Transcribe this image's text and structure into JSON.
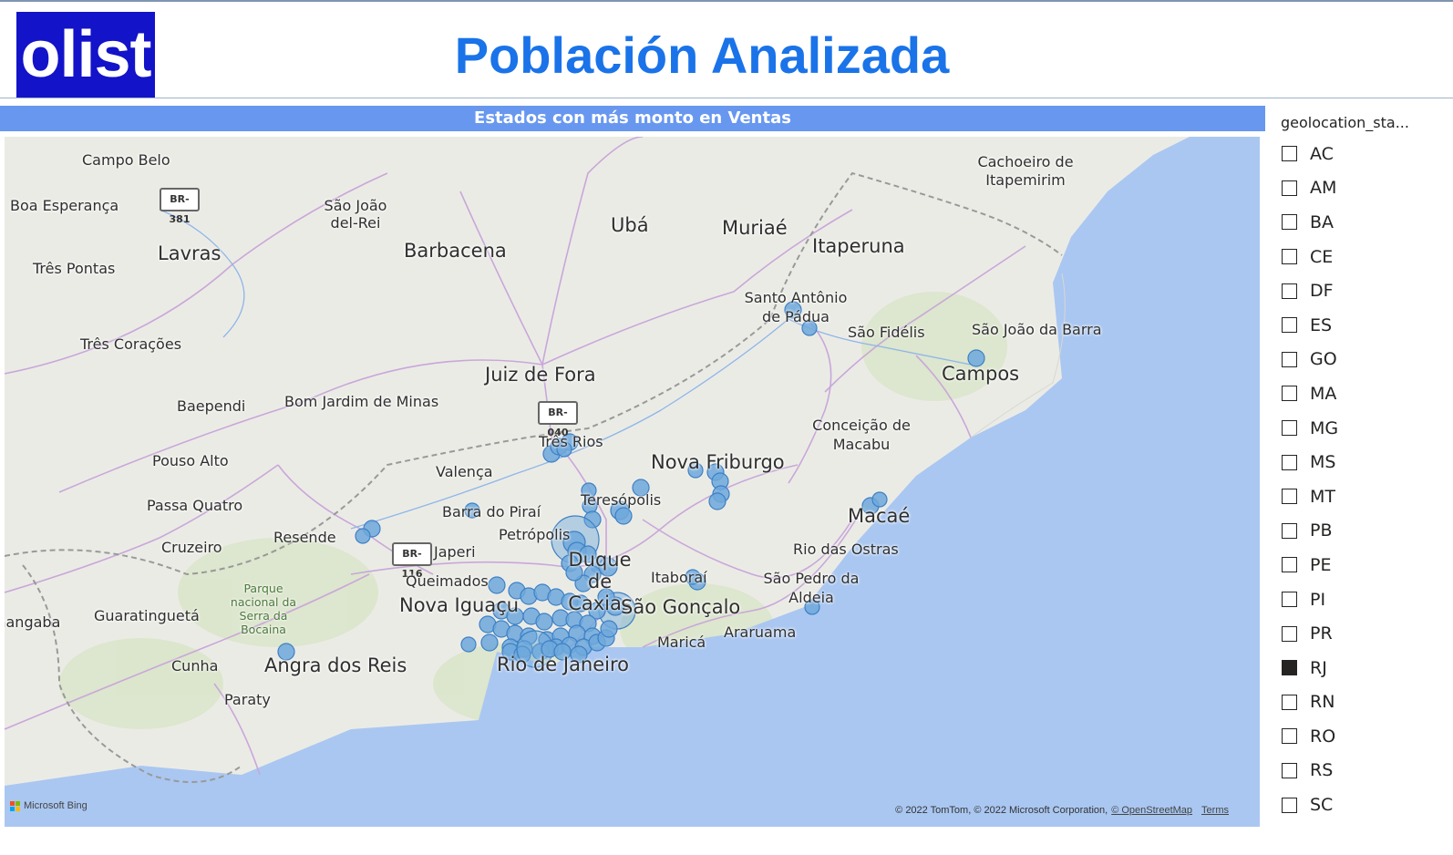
{
  "header": {
    "logo_text": "olist",
    "title": "Población Analizada"
  },
  "colors": {
    "title_blue": "#1a73e8",
    "logo_bg": "#1313c9",
    "map_header_bg": "#6897f0",
    "bubble_fill": "#6fa8dc",
    "bubble_stroke": "#3d80c4",
    "water": "#aac7f1"
  },
  "map_visual": {
    "title": "Estados con más monto en Ventas",
    "place_labels": [
      "Campo Belo",
      "Boa Esperança",
      "São João del-Rei",
      "Lavras",
      "Barbacena",
      "Ubá",
      "Muriaé",
      "Cachoeiro de Itapemirim",
      "Itaperuna",
      "Três Pontas",
      "Santo Antônio de Pádua",
      "São Fidélis",
      "São João da Barra",
      "Três Corações",
      "Campos",
      "Juiz de Fora",
      "Baependi",
      "Bom Jardim de Minas",
      "Conceição de Macabu",
      "Três Rios",
      "Pouso Alto",
      "Valença",
      "Nova Friburgo",
      "Teresópolis",
      "Barra do Piraí",
      "Passa Quatro",
      "Macaé",
      "Petrópolis",
      "Resende",
      "Cruzeiro",
      "Japeri",
      "Rio das Ostras",
      "Duque de Caxias",
      "Queimados",
      "Itaboraí",
      "São Pedro da Aldeia",
      "Parque nacional da Serra da Bocaina",
      "Nova Iguaçu",
      "São Gonçalo",
      "Pindamonhangaba",
      "Guaratinguetá",
      "Araruama",
      "Maricá",
      "Rio de Janeiro",
      "Cunha",
      "Angra dos Reis",
      "Paraty"
    ],
    "road_shields": [
      "BR-381",
      "BR-040",
      "BR-116"
    ],
    "provider_logo": "Microsoft Bing",
    "attribution": "© 2022 TomTom, © 2022 Microsoft Corporation,",
    "attribution_link": "© OpenStreetMap",
    "terms_link": "Terms",
    "map_icons": [
      "bing-logo-icon"
    ]
  },
  "slicer": {
    "header": "geolocation_sta...",
    "items": [
      {
        "label": "AC",
        "checked": false
      },
      {
        "label": "AM",
        "checked": false
      },
      {
        "label": "BA",
        "checked": false
      },
      {
        "label": "CE",
        "checked": false
      },
      {
        "label": "DF",
        "checked": false
      },
      {
        "label": "ES",
        "checked": false
      },
      {
        "label": "GO",
        "checked": false
      },
      {
        "label": "MA",
        "checked": false
      },
      {
        "label": "MG",
        "checked": false
      },
      {
        "label": "MS",
        "checked": false
      },
      {
        "label": "MT",
        "checked": false
      },
      {
        "label": "PB",
        "checked": false
      },
      {
        "label": "PE",
        "checked": false
      },
      {
        "label": "PI",
        "checked": false
      },
      {
        "label": "PR",
        "checked": false
      },
      {
        "label": "RJ",
        "checked": true
      },
      {
        "label": "RN",
        "checked": false
      },
      {
        "label": "RO",
        "checked": false
      },
      {
        "label": "RS",
        "checked": false
      },
      {
        "label": "SC",
        "checked": false
      }
    ]
  }
}
